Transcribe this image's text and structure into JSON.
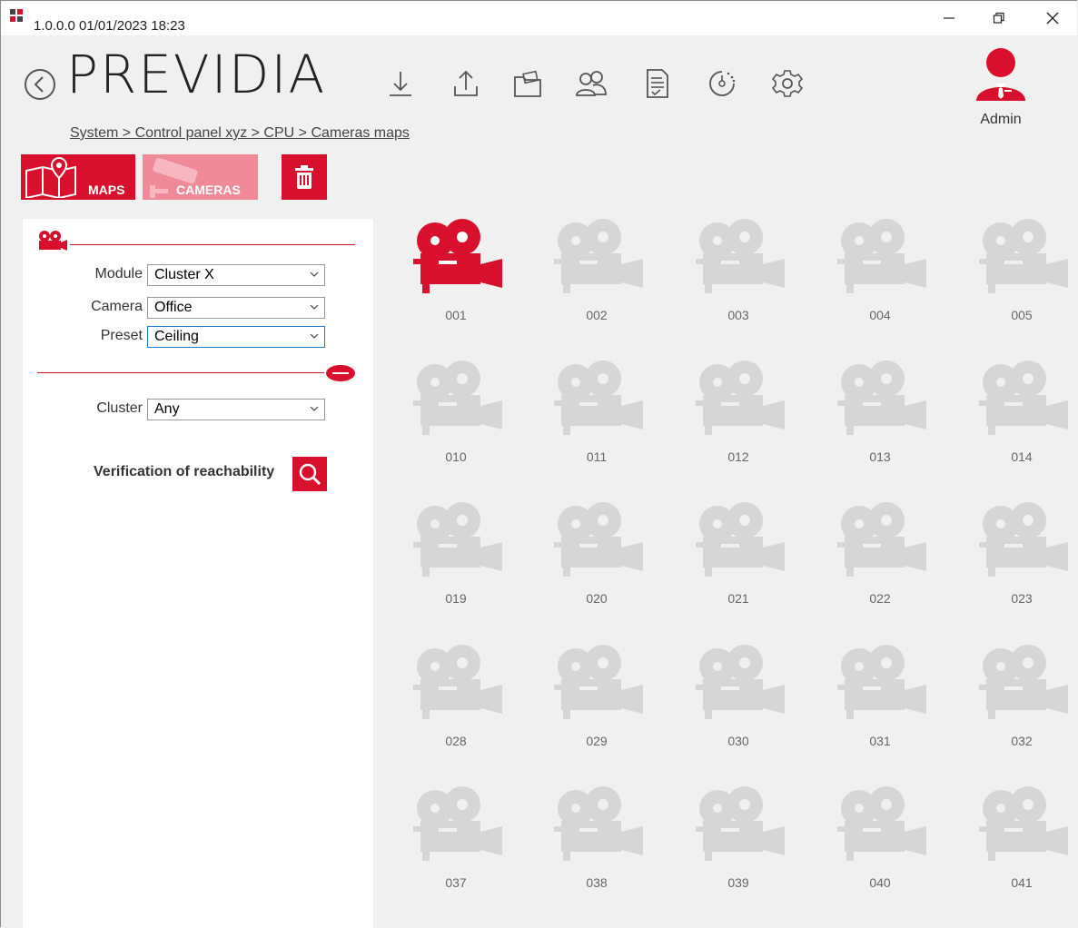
{
  "window": {
    "title": "1.0.0.0 01/01/2023 18:23",
    "minimize_label": "–"
  },
  "header": {
    "logo": "PREVIDIA",
    "icons": [
      "download-icon",
      "upload-icon",
      "folder-icon",
      "users-icon",
      "report-icon",
      "timer-icon",
      "settings-icon"
    ],
    "user": {
      "name": "Admin"
    }
  },
  "breadcrumb": "System > Control panel xyz > CPU > Cameras maps",
  "tabs": {
    "maps": "MAPS",
    "cameras": "CAMERAS"
  },
  "filters": {
    "module_label": "Module",
    "module_value": "Cluster X",
    "camera_label": "Camera",
    "camera_value": "Office",
    "preset_label": "Preset",
    "preset_value": "Ceiling",
    "cluster_label": "Cluster",
    "cluster_value": "Any",
    "verify_label": "Verification of reachability"
  },
  "colors": {
    "accent": "#d8102d",
    "accent_light": "#f08a99",
    "inactive_camera": "#d6d6d6"
  },
  "cameras": [
    [
      "001",
      "002",
      "003",
      "004",
      "005"
    ],
    [
      "010",
      "011",
      "012",
      "013",
      "014"
    ],
    [
      "019",
      "020",
      "021",
      "022",
      "023"
    ],
    [
      "028",
      "029",
      "030",
      "031",
      "032"
    ],
    [
      "037",
      "038",
      "039",
      "040",
      "041"
    ]
  ],
  "active_camera": "001"
}
